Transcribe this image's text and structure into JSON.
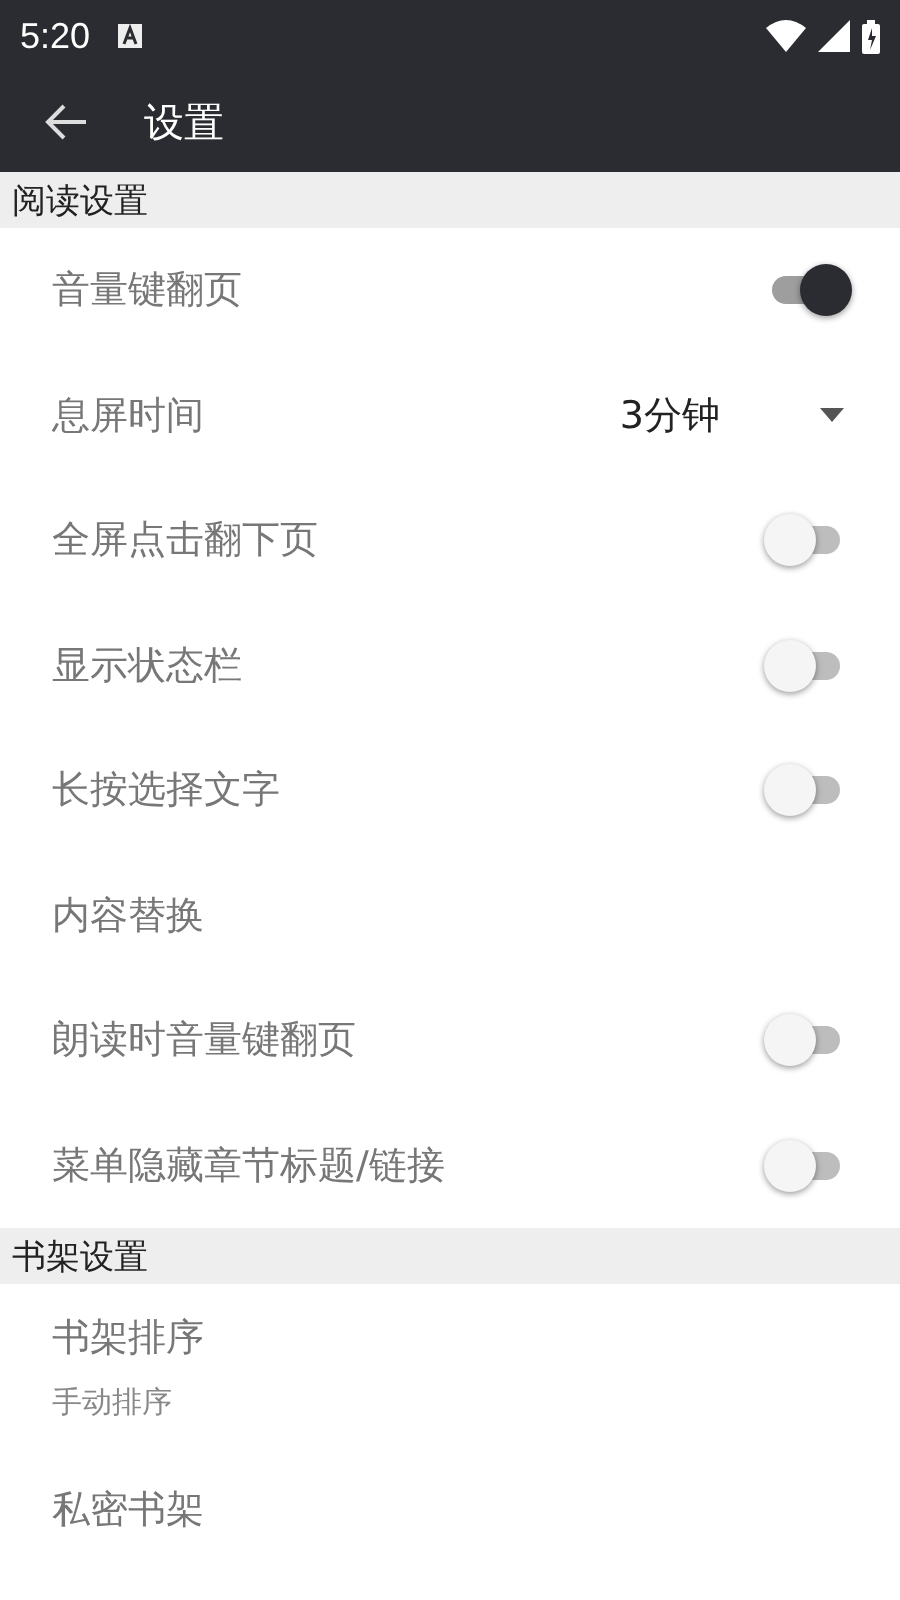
{
  "status_bar": {
    "time": "5:20"
  },
  "toolbar": {
    "title": "设置"
  },
  "sections": [
    {
      "title": "阅读设置",
      "items": [
        {
          "kind": "switch",
          "label": "音量键翻页",
          "on": true
        },
        {
          "kind": "dropdown",
          "label": "息屏时间",
          "value": "3分钟"
        },
        {
          "kind": "switch",
          "label": "全屏点击翻下页",
          "on": false
        },
        {
          "kind": "switch",
          "label": "显示状态栏",
          "on": false
        },
        {
          "kind": "switch",
          "label": "长按选择文字",
          "on": false
        },
        {
          "kind": "plain",
          "label": "内容替换"
        },
        {
          "kind": "switch",
          "label": "朗读时音量键翻页",
          "on": false
        },
        {
          "kind": "switch",
          "label": "菜单隐藏章节标题/链接",
          "on": false
        }
      ]
    },
    {
      "title": "书架设置",
      "items": [
        {
          "kind": "plain",
          "label": "书架排序",
          "summary": "手动排序"
        },
        {
          "kind": "plain",
          "label": "私密书架"
        }
      ]
    }
  ]
}
